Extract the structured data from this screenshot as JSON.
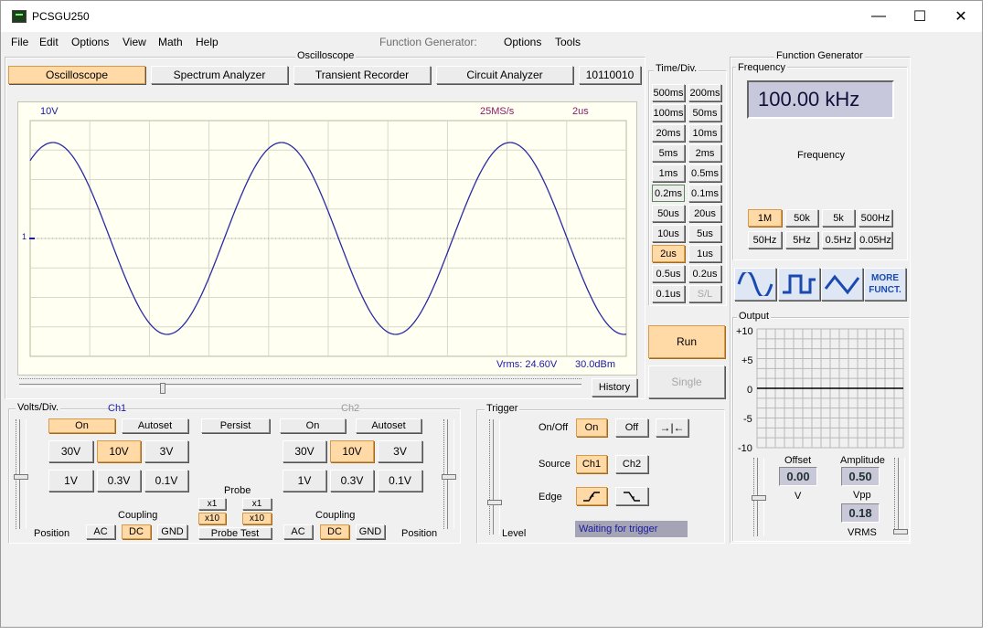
{
  "window": {
    "title": "PCSGU250",
    "minimize": "—",
    "maximize": "☐",
    "close": "✕"
  },
  "menu": {
    "left": [
      "File",
      "Edit",
      "Options",
      "View",
      "Math",
      "Help"
    ],
    "fg_label": "Function Generator:",
    "fg_items": [
      "Options",
      "Tools"
    ]
  },
  "oscilloscope": {
    "group_title": "Oscilloscope",
    "tabs": [
      "Oscilloscope",
      "Spectrum Analyzer",
      "Transient Recorder",
      "Circuit Analyzer",
      "10110010"
    ],
    "active_tab": "Oscilloscope",
    "screen": {
      "volts_label": "10V",
      "rate": "25MS/s",
      "timebase": "2us",
      "vrms": "Vrms: 24.60V",
      "dbm": "30.0dBm",
      "marker": "1"
    },
    "waveform_color": "#2a2aa6",
    "history": "History"
  },
  "timediv": {
    "title": "Time/Div.",
    "buttons": [
      "500ms",
      "200ms",
      "100ms",
      "50ms",
      "20ms",
      "10ms",
      "5ms",
      "2ms",
      "1ms",
      "0.5ms",
      "0.2ms",
      "0.1ms",
      "50us",
      "20us",
      "10us",
      "5us",
      "2us",
      "1us",
      "0.5us",
      "0.2us",
      "0.1us",
      "S/L"
    ],
    "selected": "2us",
    "run": "Run",
    "single": "Single"
  },
  "volts": {
    "title": "Volts/Div.",
    "ch1": "Ch1",
    "ch2": "Ch2",
    "on": "On",
    "autoset": "Autoset",
    "persist": "Persist",
    "ranges": [
      "30V",
      "10V",
      "3V",
      "1V",
      "0.3V",
      "0.1V"
    ],
    "selected": "10V",
    "probe": "Probe",
    "x1": "x1",
    "x10": "x10",
    "probe_test": "Probe Test",
    "coupling": "Coupling",
    "ac": "AC",
    "dc": "DC",
    "gnd": "GND",
    "position": "Position"
  },
  "trigger": {
    "title": "Trigger",
    "onoff_label": "On/Off",
    "on": "On",
    "off": "Off",
    "source_label": "Source",
    "ch1": "Ch1",
    "ch2": "Ch2",
    "edge_label": "Edge",
    "level": "Level",
    "status": "Waiting for trigger"
  },
  "fg": {
    "title": "Function Generator",
    "freq_title": "Frequency",
    "freq_display": "100.00 kHz",
    "freq_label": "Frequency",
    "ranges": [
      "1M",
      "50k",
      "5k",
      "500Hz",
      "50Hz",
      "5Hz",
      "0.5Hz",
      "0.05Hz"
    ],
    "selected": "1M",
    "more": "MORE FUNCT.",
    "output_title": "Output",
    "yticks": [
      "+10",
      "+5",
      "0",
      "-5",
      "-10"
    ],
    "offset_label": "Offset",
    "offset": "0.00",
    "offset_unit": "V",
    "amplitude_label": "Amplitude",
    "amplitude": "0.50",
    "vpp": "Vpp",
    "vrms_value": "0.18",
    "vrms": "VRMS"
  }
}
